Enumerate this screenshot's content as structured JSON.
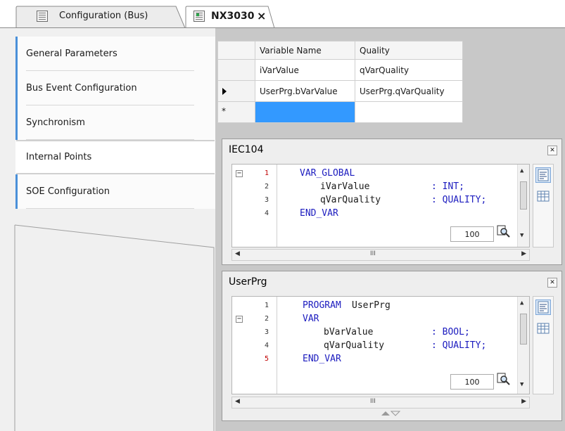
{
  "tabs": [
    {
      "label": "Configuration (Bus)",
      "icon": "bus-config-icon",
      "active": false
    },
    {
      "label": "NX3030",
      "icon": "nx3030-device-icon",
      "active": true,
      "close": "×"
    }
  ],
  "nav": {
    "items": [
      {
        "label": "General Parameters",
        "active": false
      },
      {
        "label": "Bus Event Configuration",
        "active": false
      },
      {
        "label": "Synchronism",
        "active": false
      },
      {
        "label": "Internal Points",
        "active": true
      },
      {
        "label": "SOE Configuration",
        "active": false
      }
    ]
  },
  "grid": {
    "headers": [
      "Variable Name",
      "Quality"
    ],
    "rows": [
      {
        "marker": "",
        "variable": "iVarValue",
        "quality": "qVarQuality"
      },
      {
        "marker": "current-row-arrow",
        "variable": "UserPrg.bVarValue",
        "quality": "UserPrg.qVarQuality"
      },
      {
        "marker": "*",
        "variable": "",
        "quality": ""
      }
    ]
  },
  "iec_window": {
    "title": "IEC104",
    "lines": [
      {
        "num": "1",
        "text": "VAR_GLOBAL"
      },
      {
        "num": "2",
        "name": "iVarValue",
        "type": ": INT;"
      },
      {
        "num": "3",
        "name": "qVarQuality",
        "type": ": QUALITY;"
      },
      {
        "num": "4",
        "text": "END_VAR"
      }
    ],
    "zoom": "100",
    "scroll_grip": "III"
  },
  "user_window": {
    "title": "UserPrg",
    "lines": [
      {
        "num": "1",
        "kw": "PROGRAM",
        "text": "UserPrg"
      },
      {
        "num": "2",
        "text": "VAR"
      },
      {
        "num": "3",
        "name": "bVarValue",
        "type": ": BOOL;"
      },
      {
        "num": "4",
        "name": "qVarQuality",
        "type": ": QUALITY;"
      },
      {
        "num": "5",
        "text": "END_VAR"
      }
    ],
    "zoom": "100",
    "scroll_grip": "III"
  },
  "colors": {
    "accent": "#4a90d9",
    "selected_cell": "#3399ff",
    "keyword": "#1c1cbf",
    "line_number_red": "#c00000",
    "panel_gray": "#c8c8c8"
  }
}
